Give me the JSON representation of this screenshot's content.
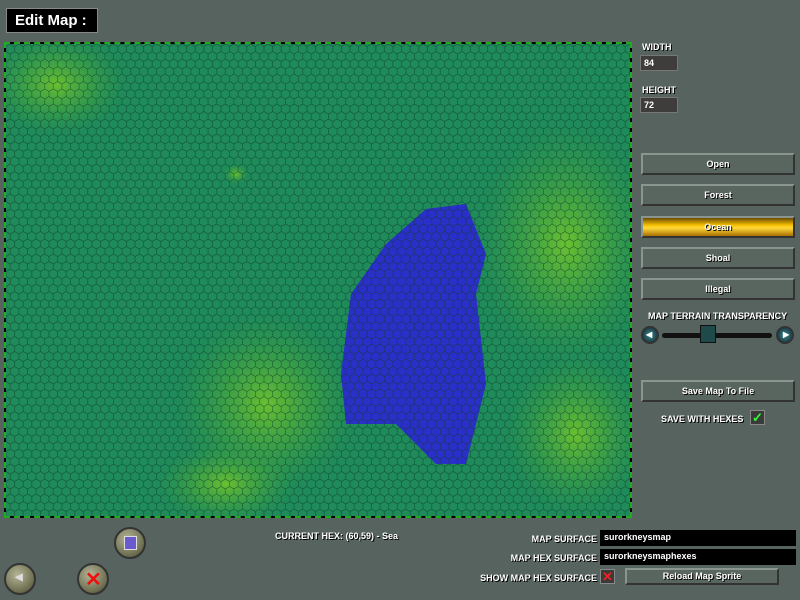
{
  "title": "Edit Map :",
  "width": {
    "label": "WIDTH",
    "value": "84"
  },
  "height": {
    "label": "HEIGHT",
    "value": "72"
  },
  "terrain_buttons": [
    "Open",
    "Forest",
    "Ocean",
    "Shoal",
    "Illegal"
  ],
  "selected_terrain": "Ocean",
  "transparency": {
    "label": "MAP TERRAIN TRANSPARENCY",
    "value_fraction": 0.4
  },
  "save_map_label": "Save Map To File",
  "save_with_hexes": {
    "label": "SAVE WITH HEXES",
    "checked": true
  },
  "current_hex": "CURRENT HEX: (60,59) - Sea",
  "map_surface": {
    "label": "MAP SURFACE",
    "value": "surorkneysmap"
  },
  "map_hex_surface": {
    "label": "MAP HEX SURFACE",
    "value": "surorkneysmaphexes"
  },
  "show_hex_surface": {
    "label": "SHOW MAP HEX SURFACE",
    "checked": false
  },
  "reload_label": "Reload Map Sprite",
  "colors": {
    "sea": "#1f8a5a",
    "land": "#4caa28",
    "lake": "#2a2fc8"
  }
}
